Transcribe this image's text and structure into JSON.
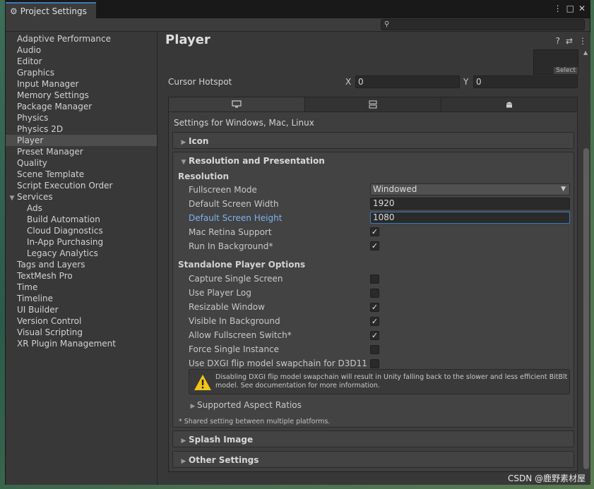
{
  "window": {
    "title": "Project Settings",
    "controls": [
      "⋮",
      "□",
      "✕"
    ]
  },
  "search": {
    "placeholder": "",
    "icon": "search-icon"
  },
  "sidebar": {
    "items": [
      {
        "label": "Adaptive Performance",
        "level": 0
      },
      {
        "label": "Audio",
        "level": 0
      },
      {
        "label": "Editor",
        "level": 0
      },
      {
        "label": "Graphics",
        "level": 0
      },
      {
        "label": "Input Manager",
        "level": 0
      },
      {
        "label": "Memory Settings",
        "level": 0
      },
      {
        "label": "Package Manager",
        "level": 0
      },
      {
        "label": "Physics",
        "level": 0
      },
      {
        "label": "Physics 2D",
        "level": 0
      },
      {
        "label": "Player",
        "level": 0,
        "active": true
      },
      {
        "label": "Preset Manager",
        "level": 0
      },
      {
        "label": "Quality",
        "level": 0
      },
      {
        "label": "Scene Template",
        "level": 0
      },
      {
        "label": "Script Execution Order",
        "level": 0
      },
      {
        "label": "Services",
        "level": 0,
        "group": true
      },
      {
        "label": "Ads",
        "level": 1
      },
      {
        "label": "Build Automation",
        "level": 1
      },
      {
        "label": "Cloud Diagnostics",
        "level": 1
      },
      {
        "label": "In-App Purchasing",
        "level": 1
      },
      {
        "label": "Legacy Analytics",
        "level": 1
      },
      {
        "label": "Tags and Layers",
        "level": 0
      },
      {
        "label": "TextMesh Pro",
        "level": 0
      },
      {
        "label": "Time",
        "level": 0
      },
      {
        "label": "Timeline",
        "level": 0
      },
      {
        "label": "UI Builder",
        "level": 0
      },
      {
        "label": "Version Control",
        "level": 0
      },
      {
        "label": "Visual Scripting",
        "level": 0
      },
      {
        "label": "XR Plugin Management",
        "level": 0
      }
    ]
  },
  "main": {
    "title": "Player",
    "thumb_button": "Select",
    "cursor_hotspot": {
      "label": "Cursor Hotspot",
      "x_label": "X",
      "x": "0",
      "y_label": "Y",
      "y": "0"
    },
    "platform_tabs": [
      "monitor-icon",
      "server-icon",
      "android-icon"
    ],
    "settings_for": "Settings for Windows, Mac, Linux",
    "icon_fold": "Icon",
    "resolution": {
      "title": "Resolution and Presentation",
      "sub1": "Resolution",
      "fullscreen_mode_label": "Fullscreen Mode",
      "fullscreen_mode": "Windowed",
      "width_label": "Default Screen Width",
      "width": "1920",
      "height_label": "Default Screen Height",
      "height": "1080",
      "mac_retina_label": "Mac Retina Support",
      "mac_retina": true,
      "run_bg_label": "Run In Background*",
      "run_bg": true,
      "sub2": "Standalone Player Options",
      "options": [
        {
          "label": "Capture Single Screen",
          "checked": false
        },
        {
          "label": "Use Player Log",
          "checked": false
        },
        {
          "label": "Resizable Window",
          "checked": true
        },
        {
          "label": "Visible In Background",
          "checked": true
        },
        {
          "label": "Allow Fullscreen Switch*",
          "checked": true
        },
        {
          "label": "Force Single Instance",
          "checked": false
        },
        {
          "label": "Use DXGI flip model swapchain for D3D11",
          "checked": false
        }
      ],
      "warning_line1": "Disabling DXGI flip model swapchain will result in Unity falling back to the slower and less efficient BitBlt",
      "warning_line2": "model. See documentation for more information.",
      "aspect": "Supported Aspect Ratios",
      "shared_note": "* Shared setting between multiple platforms."
    },
    "splash_fold": "Splash Image",
    "other_fold": "Other Settings"
  },
  "watermark": "CSDN @鹿野素材屋"
}
